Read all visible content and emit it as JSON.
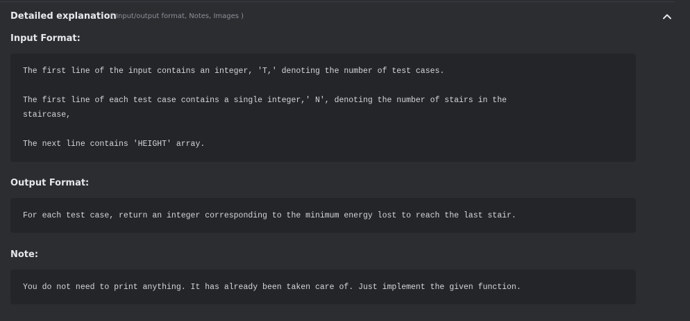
{
  "header": {
    "title": "Detailed explanation",
    "subtitle": "( Input/output format, Notes, Images )",
    "collapse_icon": "chevron-up-icon"
  },
  "input_format": {
    "heading": "Input Format:",
    "lines": [
      "The first line of the input contains an integer, 'T,' denoting the number of test cases.",
      "The first line of each test case contains a single integer,' N', denoting the number of stairs in the",
      "staircase,",
      "The next line contains 'HEIGHT' array."
    ]
  },
  "output_format": {
    "heading": "Output Format:",
    "lines": [
      "For each test case, return an integer corresponding to the minimum energy lost to reach the last stair."
    ]
  },
  "note": {
    "heading": "Note:",
    "lines": [
      "You do not need to print anything. It has already been taken care of. Just implement the given function."
    ]
  },
  "colors": {
    "background": "#2b2d31",
    "code_background": "#232529",
    "text": "#e6e7ea",
    "muted": "#8d9097"
  }
}
